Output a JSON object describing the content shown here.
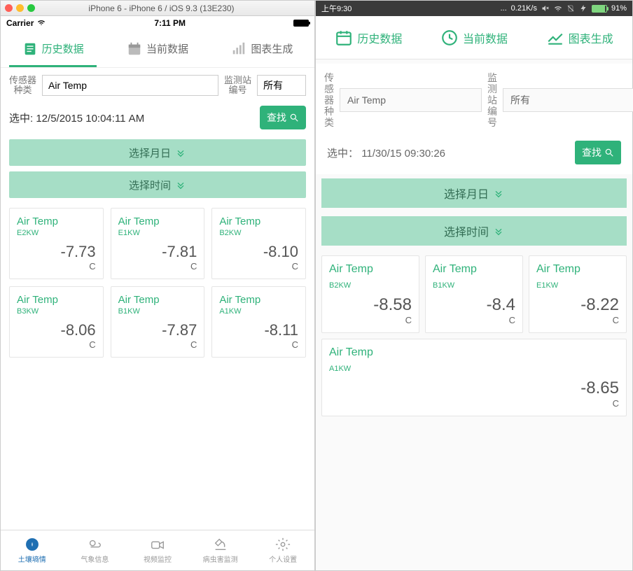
{
  "ios": {
    "windowTitle": "iPhone 6 - iPhone 6 / iOS 9.3 (13E230)",
    "carrier": "Carrier",
    "time": "7:11 PM",
    "tabs": [
      {
        "label": "历史数据",
        "icon": "document-icon"
      },
      {
        "label": "当前数据",
        "icon": "calendar-icon"
      },
      {
        "label": "图表生成",
        "icon": "chart-icon"
      }
    ],
    "sensorLabel": "传感器\n种类",
    "sensorValue": "Air Temp",
    "stationLabel": "监测站\n编号",
    "stationValue": "所有",
    "selectedLabel": "选中:",
    "selectedValue": "12/5/2015 10:04:11 AM",
    "searchLabel": "查找",
    "barDate": "选择月日",
    "barTime": "选择时间",
    "cards": [
      {
        "title": "Air Temp",
        "sub": "E2KW",
        "val": "-7.73",
        "unit": "C"
      },
      {
        "title": "Air Temp",
        "sub": "E1KW",
        "val": "-7.81",
        "unit": "C"
      },
      {
        "title": "Air Temp",
        "sub": "B2KW",
        "val": "-8.10",
        "unit": "C"
      },
      {
        "title": "Air Temp",
        "sub": "B3KW",
        "val": "-8.06",
        "unit": "C"
      },
      {
        "title": "Air Temp",
        "sub": "B1KW",
        "val": "-7.87",
        "unit": "C"
      },
      {
        "title": "Air Temp",
        "sub": "A1KW",
        "val": "-8.11",
        "unit": "C"
      }
    ],
    "footer": [
      {
        "label": "土壤墒情"
      },
      {
        "label": "气象信息"
      },
      {
        "label": "视频监控"
      },
      {
        "label": "病虫害监测"
      },
      {
        "label": "个人设置"
      }
    ]
  },
  "android": {
    "time": "上午9:30",
    "speed": "0.21K/s",
    "battery": "91%",
    "tabs": [
      {
        "label": "历史数据"
      },
      {
        "label": "当前数据"
      },
      {
        "label": "图表生成"
      }
    ],
    "sensorLabel": "传感器\n种类",
    "sensorValue": "Air Temp",
    "stationLabel": "监测站\n编号",
    "stationValue": "所有",
    "selectedLabel": "选中：",
    "selectedValue": "11/30/15 09:30:26",
    "searchLabel": "查找",
    "barDate": "选择月日",
    "barTime": "选择时间",
    "cards": [
      {
        "title": "Air Temp",
        "sub": "B2KW",
        "val": "-8.58",
        "unit": "C"
      },
      {
        "title": "Air Temp",
        "sub": "B1KW",
        "val": "-8.4",
        "unit": "C"
      },
      {
        "title": "Air Temp",
        "sub": "E1KW",
        "val": "-8.22",
        "unit": "C"
      },
      {
        "title": "Air Temp",
        "sub": "A1KW",
        "val": "-8.65",
        "unit": "C"
      }
    ]
  }
}
